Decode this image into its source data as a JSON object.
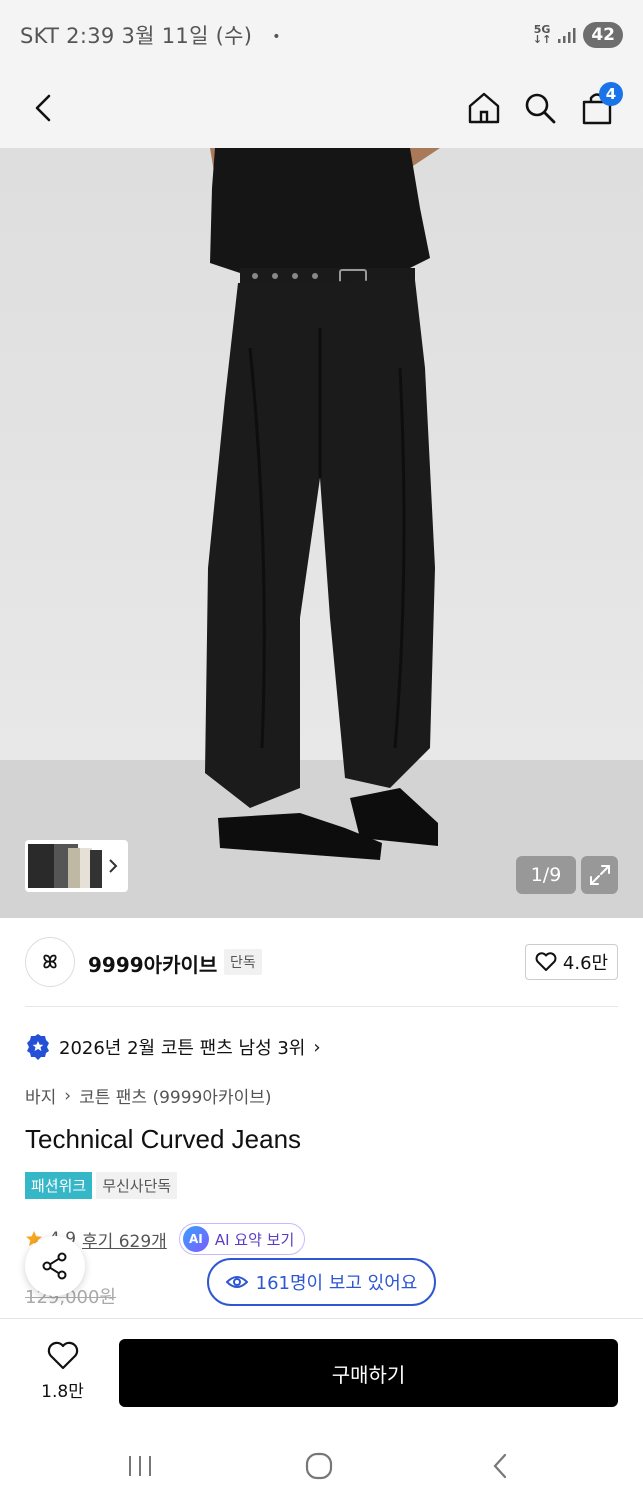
{
  "status_bar": {
    "carrier_time": "SKT 2:39  3월 11일 (수)",
    "dot": "•",
    "network_top": "5G",
    "network_bottom": "↓↑",
    "battery": "42"
  },
  "header": {
    "cart_count": "4",
    "icons": [
      "back-icon",
      "home-icon",
      "search-icon",
      "cart-icon"
    ]
  },
  "gallery": {
    "counter": "1/9"
  },
  "brand": {
    "logo_text": "ꕤ",
    "name": "9999아카이브",
    "tag": "단독",
    "like_count": "4.6만"
  },
  "ranking": {
    "text": "2026년 2월 코튼 팬츠 남성 3위",
    "arrow": "›"
  },
  "breadcrumb": {
    "category": "바지",
    "separator": "›",
    "sub": "코튼 팬츠 (9999아카이브)"
  },
  "product": {
    "title": "Technical Curved Jeans",
    "tags": [
      "패션위크",
      "무신사단독"
    ],
    "rating_partial": "4.9",
    "reviews": "후기 629개",
    "ai_badge": "AI",
    "ai_summary": "AI 요약 보기",
    "viewers": "161명이 보고 있어요",
    "old_price": "129,000원"
  },
  "bottom": {
    "wish_count": "1.8만",
    "buy_label": "구매하기"
  },
  "colors": {
    "accent_blue": "#2f57d4",
    "tag_teal": "#36b7c8",
    "badge_blue": "#1a73e8"
  }
}
